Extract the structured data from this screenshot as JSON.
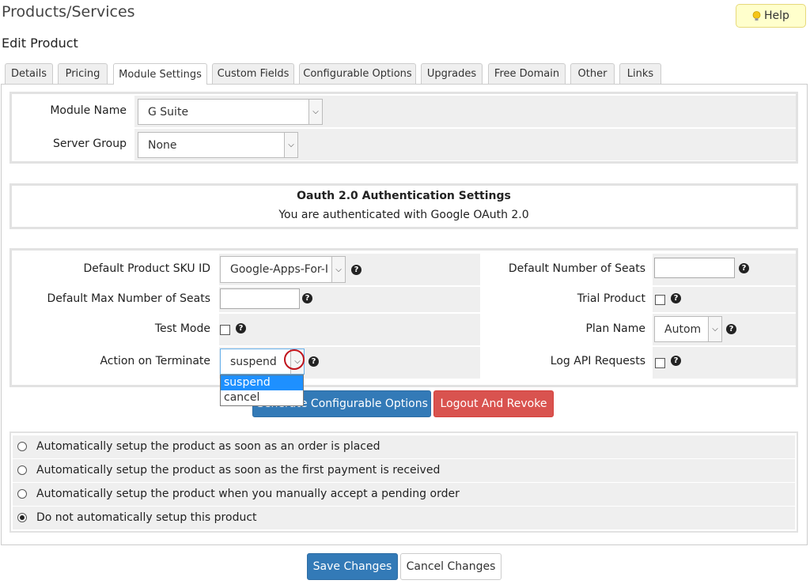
{
  "page": {
    "title": "Products/Services",
    "subtitle": "Edit Product",
    "help_label": "Help"
  },
  "tabs": [
    "Details",
    "Pricing",
    "Module Settings",
    "Custom Fields",
    "Configurable Options",
    "Upgrades",
    "Free Domain",
    "Other",
    "Links"
  ],
  "active_tab": "Module Settings",
  "module": {
    "name_label": "Module Name",
    "name_value": "G Suite",
    "server_group_label": "Server Group",
    "server_group_value": "None"
  },
  "oauth": {
    "title": "Oauth 2.0 Authentication Settings",
    "status": "You are authenticated with Google OAuth 2.0"
  },
  "config": {
    "sku_label": "Default Product SKU ID",
    "sku_value": "Google-Apps-For-I",
    "max_seats_label": "Default Max Number of Seats",
    "max_seats_value": "",
    "test_mode_label": "Test Mode",
    "terminate_label": "Action on Terminate",
    "terminate_value": "suspend",
    "seats_label": "Default Number of Seats",
    "seats_value": "",
    "trial_label": "Trial Product",
    "plan_label": "Plan Name",
    "plan_value": "Autom",
    "log_label": "Log API Requests"
  },
  "dropdown_options": [
    "suspend",
    "cancel"
  ],
  "buttons": {
    "generate": "Generate Configurable Options",
    "logout": "Logout And Revoke",
    "save": "Save Changes",
    "cancel": "Cancel Changes"
  },
  "setup_options": [
    "Automatically setup the product as soon as an order is placed",
    "Automatically setup the product as soon as the first payment is received",
    "Automatically setup the product when you manually accept a pending order",
    "Do not automatically setup this product"
  ],
  "setup_selected_index": 3,
  "colors": {
    "primary": "#337ab7",
    "danger": "#d9534f",
    "help_bg": "#ffffcc",
    "highlight_circle": "#c0141d"
  }
}
